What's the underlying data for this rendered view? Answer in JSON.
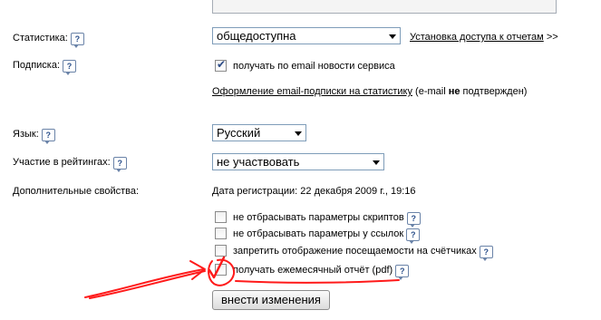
{
  "labels": {
    "statistics": "Статистика:",
    "subscription": "Подписка:",
    "language": "Язык:",
    "ratings": "Участие в рейтингах:",
    "extra": "Дополнительные свойства:"
  },
  "help_icon": "?",
  "statistics_select": {
    "value": "общедоступна"
  },
  "access_link": {
    "text": "Установка доступа к отчетам",
    "suffix": ">>"
  },
  "subscription_checkbox": {
    "label": "получать по email новости сервиса",
    "checked": true
  },
  "email_subscription": {
    "link": "Оформление email-подписки на статистику",
    "note_before": " (e-mail ",
    "note_bold": "не",
    "note_after": " подтвержден)"
  },
  "language_select": {
    "value": "Русский"
  },
  "ratings_select": {
    "value": "не участвовать"
  },
  "registration_date": "Дата регистрации: 22 декабря 2009 г., 19:16",
  "options": [
    {
      "label": "не отбрасывать параметры скриптов",
      "checked": false
    },
    {
      "label": "не отбрасывать параметры у ссылок",
      "checked": false
    },
    {
      "label": "запретить отображение посещаемости на счётчиках",
      "checked": false
    },
    {
      "label": "получать ежемесячный отчёт (pdf)",
      "checked": true
    }
  ],
  "submit_button": "внести изменения",
  "colors": {
    "annotation_red": "#ff1a1a",
    "select_border": "#7f9db9"
  }
}
